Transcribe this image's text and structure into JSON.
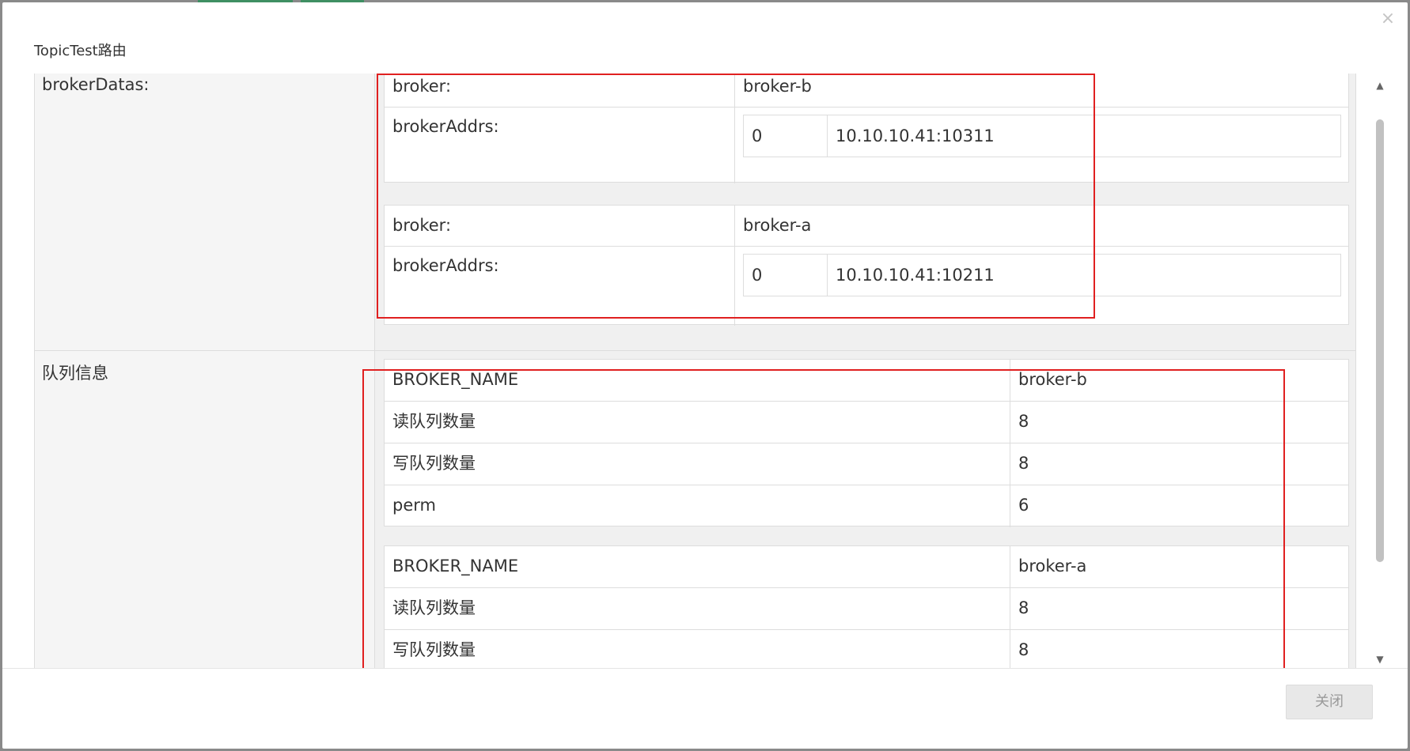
{
  "dialog": {
    "title": "TopicTest路由",
    "close_glyph": "×",
    "close_button_label": "关闭"
  },
  "sections": {
    "broker_datas": {
      "label": "brokerDatas:",
      "items": [
        {
          "broker_label": "broker:",
          "broker_value": "broker-b",
          "addrs_label": "brokerAddrs:",
          "addrs": [
            {
              "index": "0",
              "address": "10.10.10.41:10311"
            }
          ]
        },
        {
          "broker_label": "broker:",
          "broker_value": "broker-a",
          "addrs_label": "brokerAddrs:",
          "addrs": [
            {
              "index": "0",
              "address": "10.10.10.41:10211"
            }
          ]
        }
      ]
    },
    "queue_info": {
      "label": "队列信息",
      "items": [
        {
          "rows": [
            {
              "key": "BROKER_NAME",
              "value": "broker-b"
            },
            {
              "key": "读队列数量",
              "value": "8"
            },
            {
              "key": "写队列数量",
              "value": "8"
            },
            {
              "key": "perm",
              "value": "6"
            }
          ]
        },
        {
          "rows": [
            {
              "key": "BROKER_NAME",
              "value": "broker-a"
            },
            {
              "key": "读队列数量",
              "value": "8"
            },
            {
              "key": "写队列数量",
              "value": "8"
            }
          ]
        }
      ]
    }
  },
  "scrollbar": {
    "up_arrow": "▲",
    "down_arrow": "▼"
  },
  "colors": {
    "annotation_box": "#e02020",
    "key_column_bg": "#f5f5f5",
    "backdrop": "#8a8a8a"
  }
}
